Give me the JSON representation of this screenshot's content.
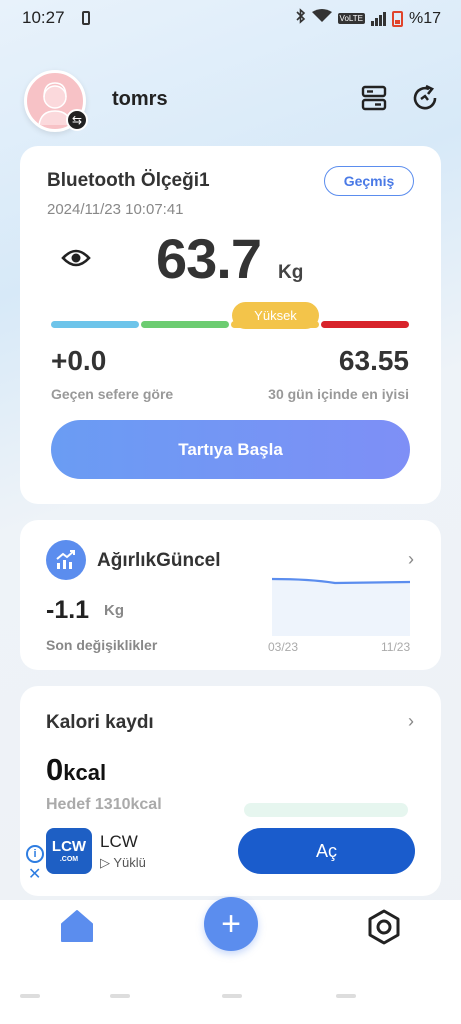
{
  "status_bar": {
    "time": "10:27",
    "volte": "VoLTE",
    "battery": "%17"
  },
  "header": {
    "username": "tomrs",
    "icons": [
      "avatar-swap-icon",
      "devices-icon",
      "sync-icon"
    ]
  },
  "scale_card": {
    "device_name": "Bluetooth Ölçeği1",
    "datetime": "2024/11/23 10:07:41",
    "history_label": "Geçmiş",
    "weight": "63.7",
    "weight_unit": "Kg",
    "level_badge": "Yüksek",
    "delta_value": "+0.0",
    "delta_label": "Geçen sefere göre",
    "best_value": "63.55",
    "best_label": "30 gün içinde en iyisi",
    "start_button": "Tartıya Başla",
    "segment_colors": [
      "#6dc4ea",
      "#6ccc71",
      "#f3c44a",
      "#d8232a"
    ]
  },
  "trend_card": {
    "title": "AğırlıkGüncel",
    "delta": "-1.1",
    "unit": "Kg",
    "label": "Son değişiklikler",
    "x_start": "03/23",
    "x_end": "11/23"
  },
  "calorie_card": {
    "title": "Kalori kaydı",
    "value": "0",
    "unit": "kcal",
    "goal": "Hedef 1310kcal"
  },
  "ad": {
    "logo_text": "LCW",
    "logo_sub": ".COM",
    "name": "LCW",
    "status": "Yüklü",
    "button": "Aç"
  },
  "colors": {
    "accent": "#5b8dee",
    "ad_button": "#1a5ccc"
  }
}
